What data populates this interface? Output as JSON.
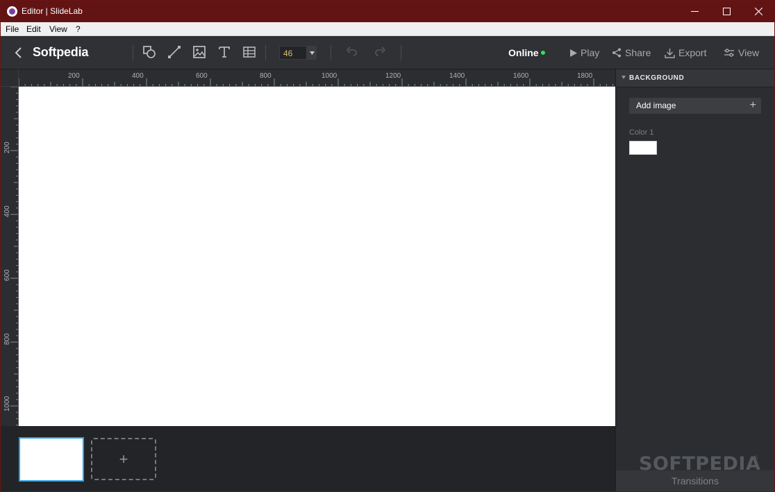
{
  "window": {
    "title": "Editor | SlideLab"
  },
  "menu": {
    "items": [
      "File",
      "Edit",
      "View",
      "?"
    ]
  },
  "toolbar": {
    "document_title": "Softpedia",
    "font_size": "46",
    "status": "Online",
    "status_color": "#2ee05a",
    "actions": {
      "play": "Play",
      "share": "Share",
      "export": "Export",
      "view": "View"
    },
    "tool_icons": [
      "shape-icon",
      "line-icon",
      "image-icon",
      "text-icon",
      "table-icon"
    ]
  },
  "ruler": {
    "horizontal_labels": [
      "200",
      "400",
      "600",
      "800",
      "1000",
      "1200",
      "1400",
      "1600",
      "1800"
    ],
    "vertical_labels": [
      "200",
      "400",
      "600",
      "800",
      "1000"
    ]
  },
  "panel": {
    "section_title": "BACKGROUND",
    "add_image_label": "Add image",
    "color_label": "Color 1",
    "color_value": "#ffffff",
    "transitions_label": "Transitions"
  },
  "slides": {
    "add_label": "+"
  },
  "watermark": {
    "text": "SOFTPEDIA",
    "mark": "®"
  },
  "colors": {
    "titlebar": "#621414",
    "accent": "#2aa2e8"
  }
}
